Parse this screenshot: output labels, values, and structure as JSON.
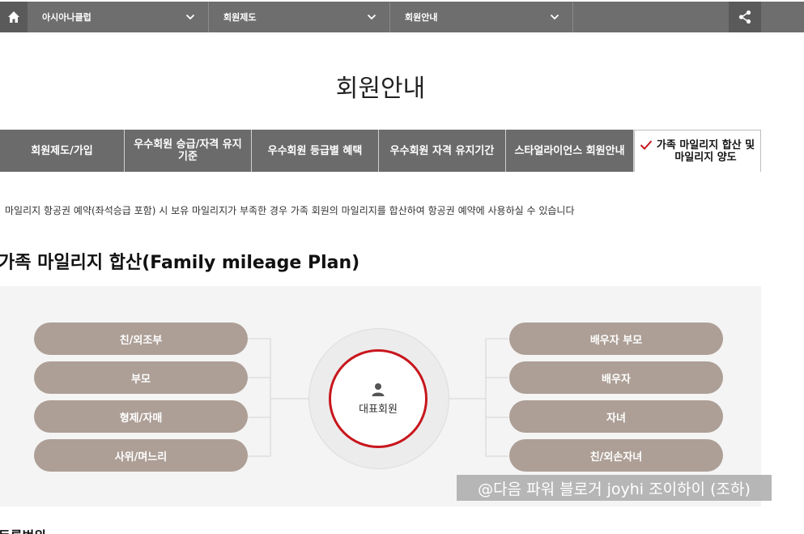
{
  "nav": {
    "select1": "아시아나클럽",
    "select2": "회원제도",
    "select3": "회원안내"
  },
  "page": {
    "title": "회원안내"
  },
  "tabs": [
    {
      "label": "회원제도/가입"
    },
    {
      "label": "우수회원 승급/자격 유지 기준"
    },
    {
      "label": "우수회원 등급별 혜택"
    },
    {
      "label": "우수회원 자격 유지기간"
    },
    {
      "label": "스타얼라이언스 회원안내"
    },
    {
      "label": "가족 마일리지 합산 및 마일리지 양도"
    }
  ],
  "content": {
    "description": "마일리지 항공권 예약(좌석승급 포함) 시 보유 마일리지가 부족한 경우 가족 회원의 마일리지를 합산하여 항공권 예약에 사용하실 수 있습니다",
    "section_title": "가족 마일리지 합산(Family mileage Plan)",
    "bottom_heading": "등록범위"
  },
  "diagram": {
    "left": [
      "친/외조부",
      "부모",
      "형제/자매",
      "사위/며느리"
    ],
    "right": [
      "배우자 부모",
      "배우자",
      "자녀",
      "친/외손자녀"
    ],
    "center": "대표회원"
  },
  "watermark": "@다음 파워 블로거 joyhi 조이하이 (조하)",
  "colors": {
    "nav_bg": "#6e6e6e",
    "pill": "#ad9f96",
    "accent_red": "#c8161d",
    "diagram_bg": "#f4f4f4"
  }
}
